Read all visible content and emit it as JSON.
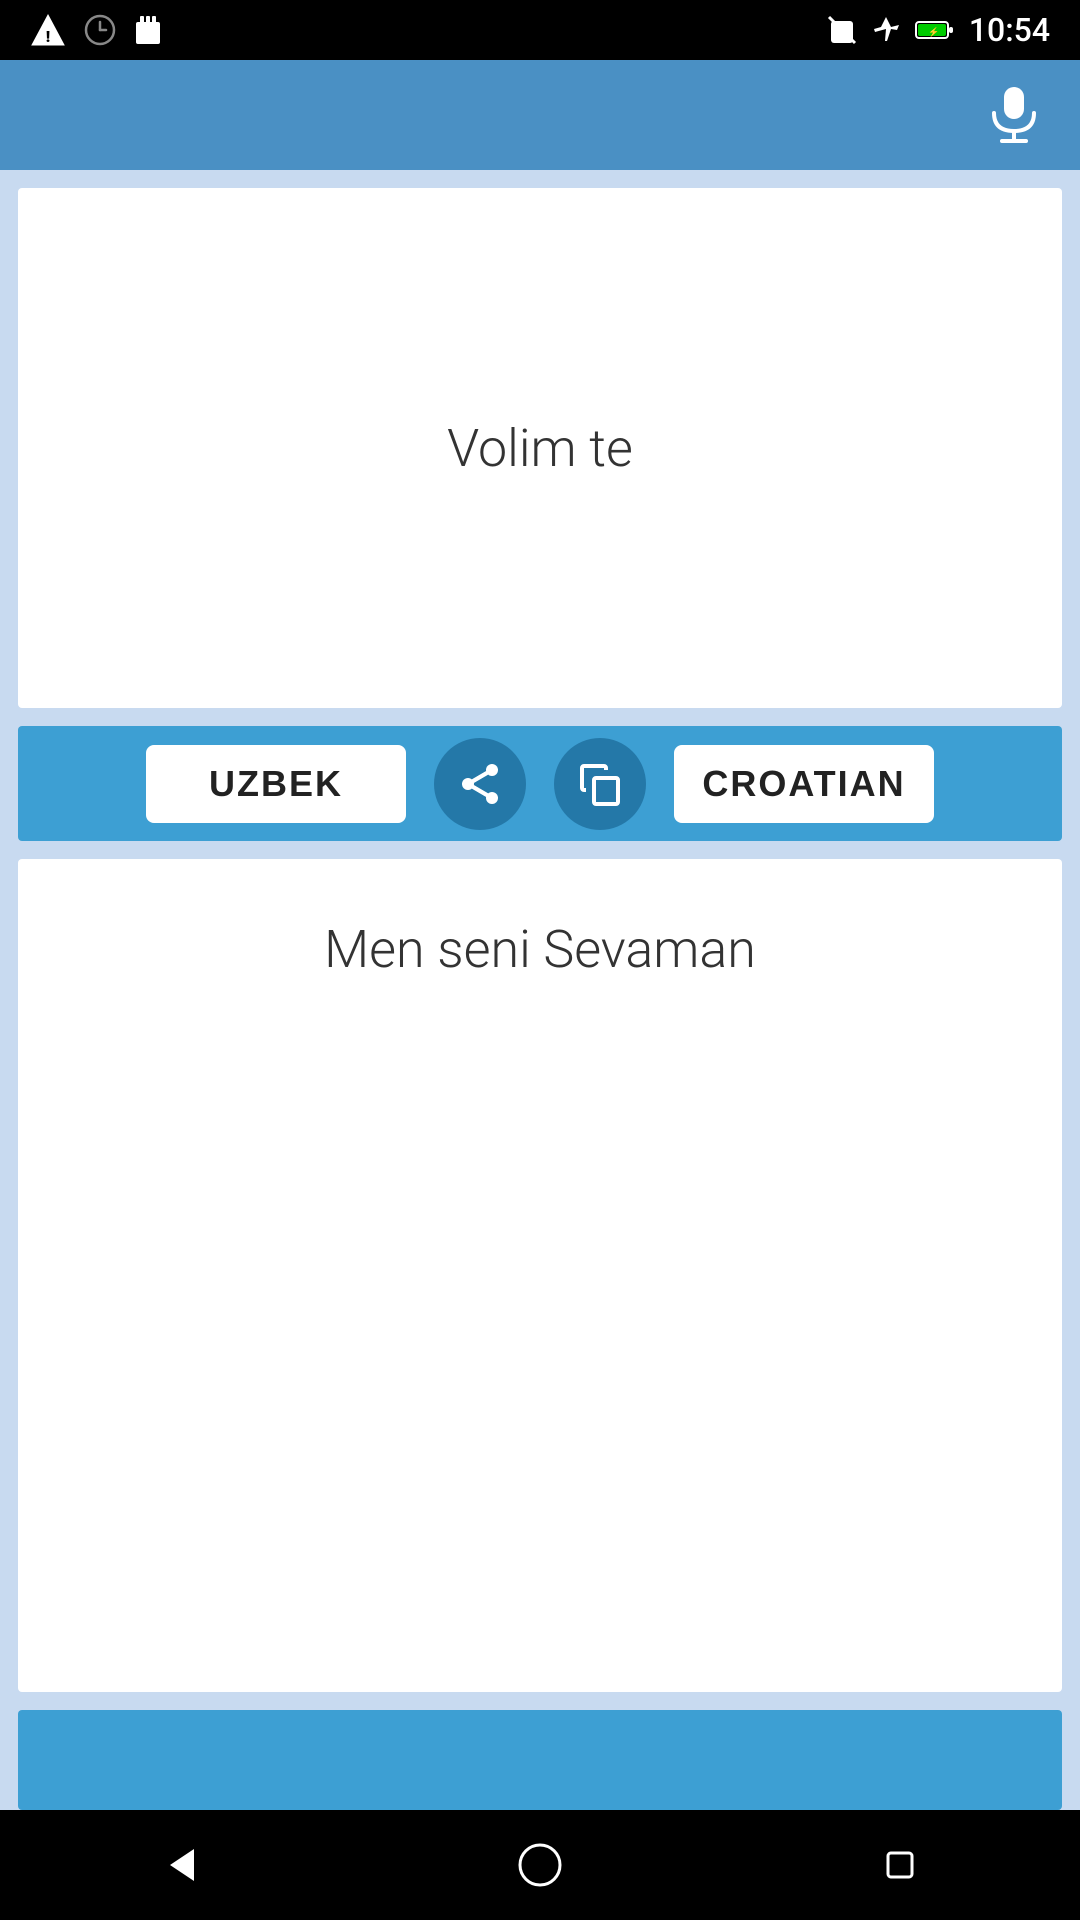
{
  "status_bar": {
    "time": "10:54",
    "left_icons": [
      "warning",
      "clock",
      "sd-card"
    ],
    "right_icons": [
      "no-sim",
      "airplane",
      "battery"
    ]
  },
  "header": {
    "mic_label": "microphone"
  },
  "source_panel": {
    "text": "Volim te"
  },
  "toolbar": {
    "source_lang": "UZBEK",
    "target_lang": "CROATIAN",
    "share_label": "share",
    "copy_label": "copy"
  },
  "translation_panel": {
    "text": "Men seni Sevaman"
  },
  "nav_bar": {
    "back_label": "back",
    "home_label": "home",
    "recents_label": "recents"
  }
}
